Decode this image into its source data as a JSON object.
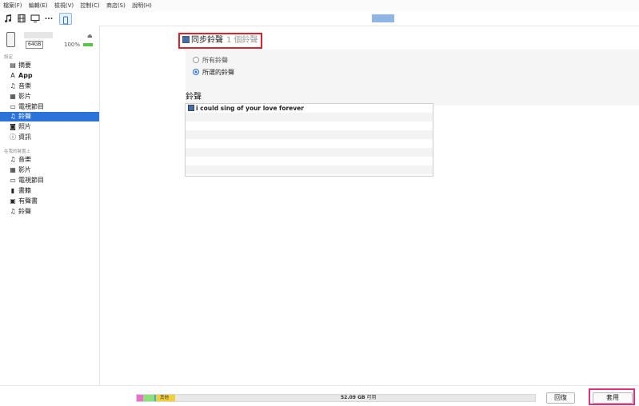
{
  "menu": [
    "檔案(F)",
    "編輯(E)",
    "檢視(V)",
    "控制(C)",
    "商店(S)",
    "說明(H)"
  ],
  "toolbar": {
    "icons": [
      "music-icon",
      "movie-icon",
      "tv-icon",
      "more-icon",
      "device-icon"
    ]
  },
  "device": {
    "capacity": "64GB",
    "battery": "100%"
  },
  "sidebar": {
    "settings_label": "設定",
    "settings_items": [
      {
        "icon": "▤",
        "label": "摘要"
      },
      {
        "icon": "A",
        "label": "App"
      },
      {
        "icon": "♫",
        "label": "音樂"
      },
      {
        "icon": "▦",
        "label": "影片"
      },
      {
        "icon": "▭",
        "label": "電視節目"
      },
      {
        "icon": "♫",
        "label": "鈴聲"
      },
      {
        "icon": "◙",
        "label": "照片"
      },
      {
        "icon": "ⓘ",
        "label": "資訊"
      }
    ],
    "on_device_label": "在我的裝置上",
    "device_items": [
      {
        "icon": "♫",
        "label": "音樂"
      },
      {
        "icon": "▦",
        "label": "影片"
      },
      {
        "icon": "▭",
        "label": "電視節目"
      },
      {
        "icon": "▮",
        "label": "書籍"
      },
      {
        "icon": "▣",
        "label": "有聲書"
      },
      {
        "icon": "♫",
        "label": "鈴聲"
      }
    ]
  },
  "sync": {
    "label": "同步鈴聲",
    "count": "1 個鈴聲",
    "option_all": "所有鈴聲",
    "option_selected": "所選的鈴聲"
  },
  "ringtones": {
    "title": "鈴聲",
    "items": [
      "i could sing of your love forever"
    ]
  },
  "footer": {
    "storage_other_label": "其他",
    "storage_free_value": "52.09 GB",
    "storage_free_suffix": "可用",
    "revert_label": "回復",
    "apply_label": "套用"
  },
  "colors": {
    "selected": "#2b73d8",
    "highlight_red": "#e0202b",
    "highlight_pink": "#e0307a"
  }
}
